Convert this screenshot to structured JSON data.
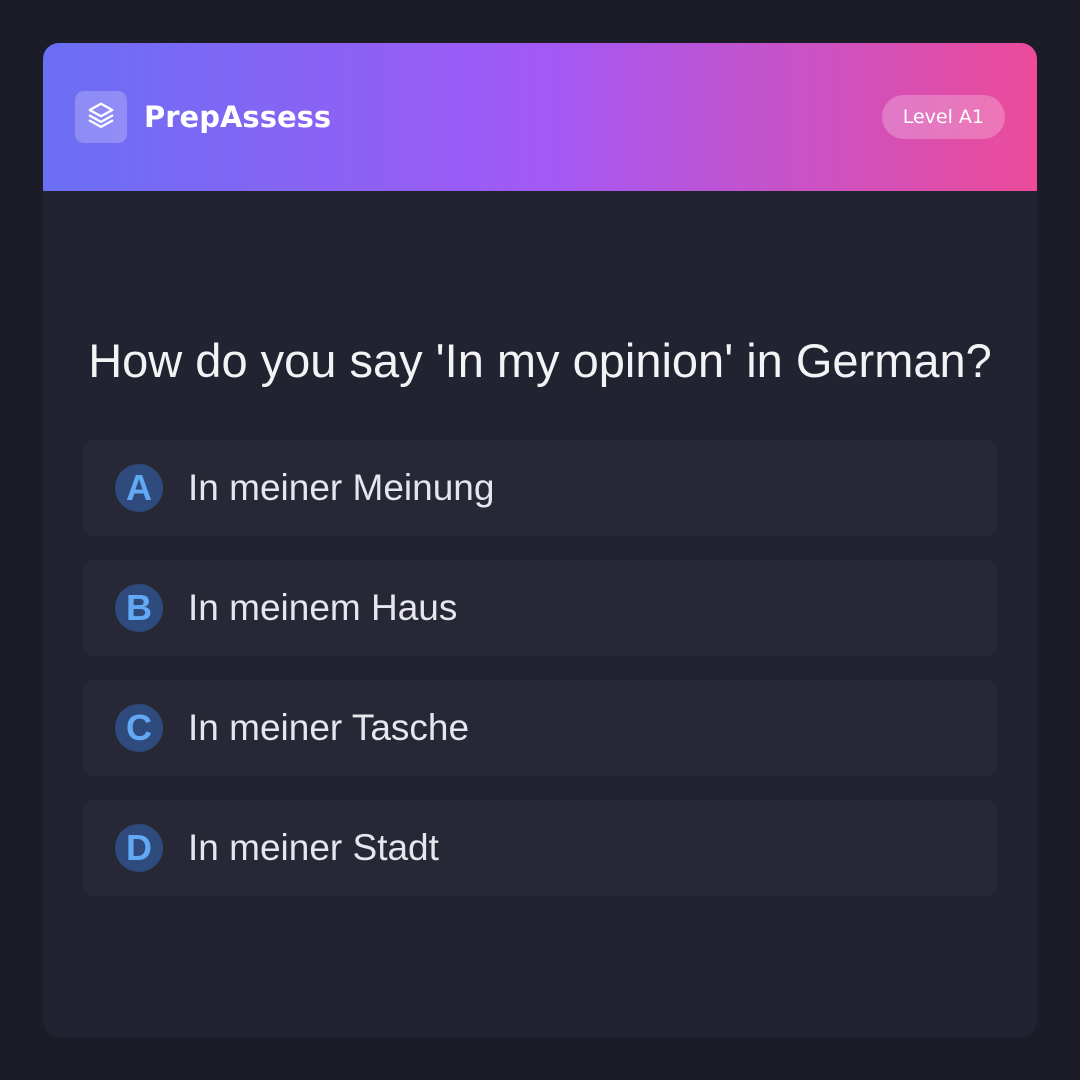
{
  "app": {
    "brand": "PrepAssess",
    "logo_icon": "layers-icon",
    "level": "Level A1"
  },
  "quiz": {
    "question": "How do you say 'In my opinion' in German?",
    "options": [
      {
        "letter": "A",
        "text": "In meiner Meinung"
      },
      {
        "letter": "B",
        "text": "In meinem Haus"
      },
      {
        "letter": "C",
        "text": "In meiner Tasche"
      },
      {
        "letter": "D",
        "text": "In meiner Stadt"
      }
    ]
  },
  "colors": {
    "gradient_start": "#6a6ff3",
    "gradient_mid": "#a259f6",
    "gradient_end": "#ec4b99",
    "background": "#1b1c28",
    "card": "#212330",
    "option_bg": "#272836",
    "letter_accent": "#62a9f5"
  }
}
